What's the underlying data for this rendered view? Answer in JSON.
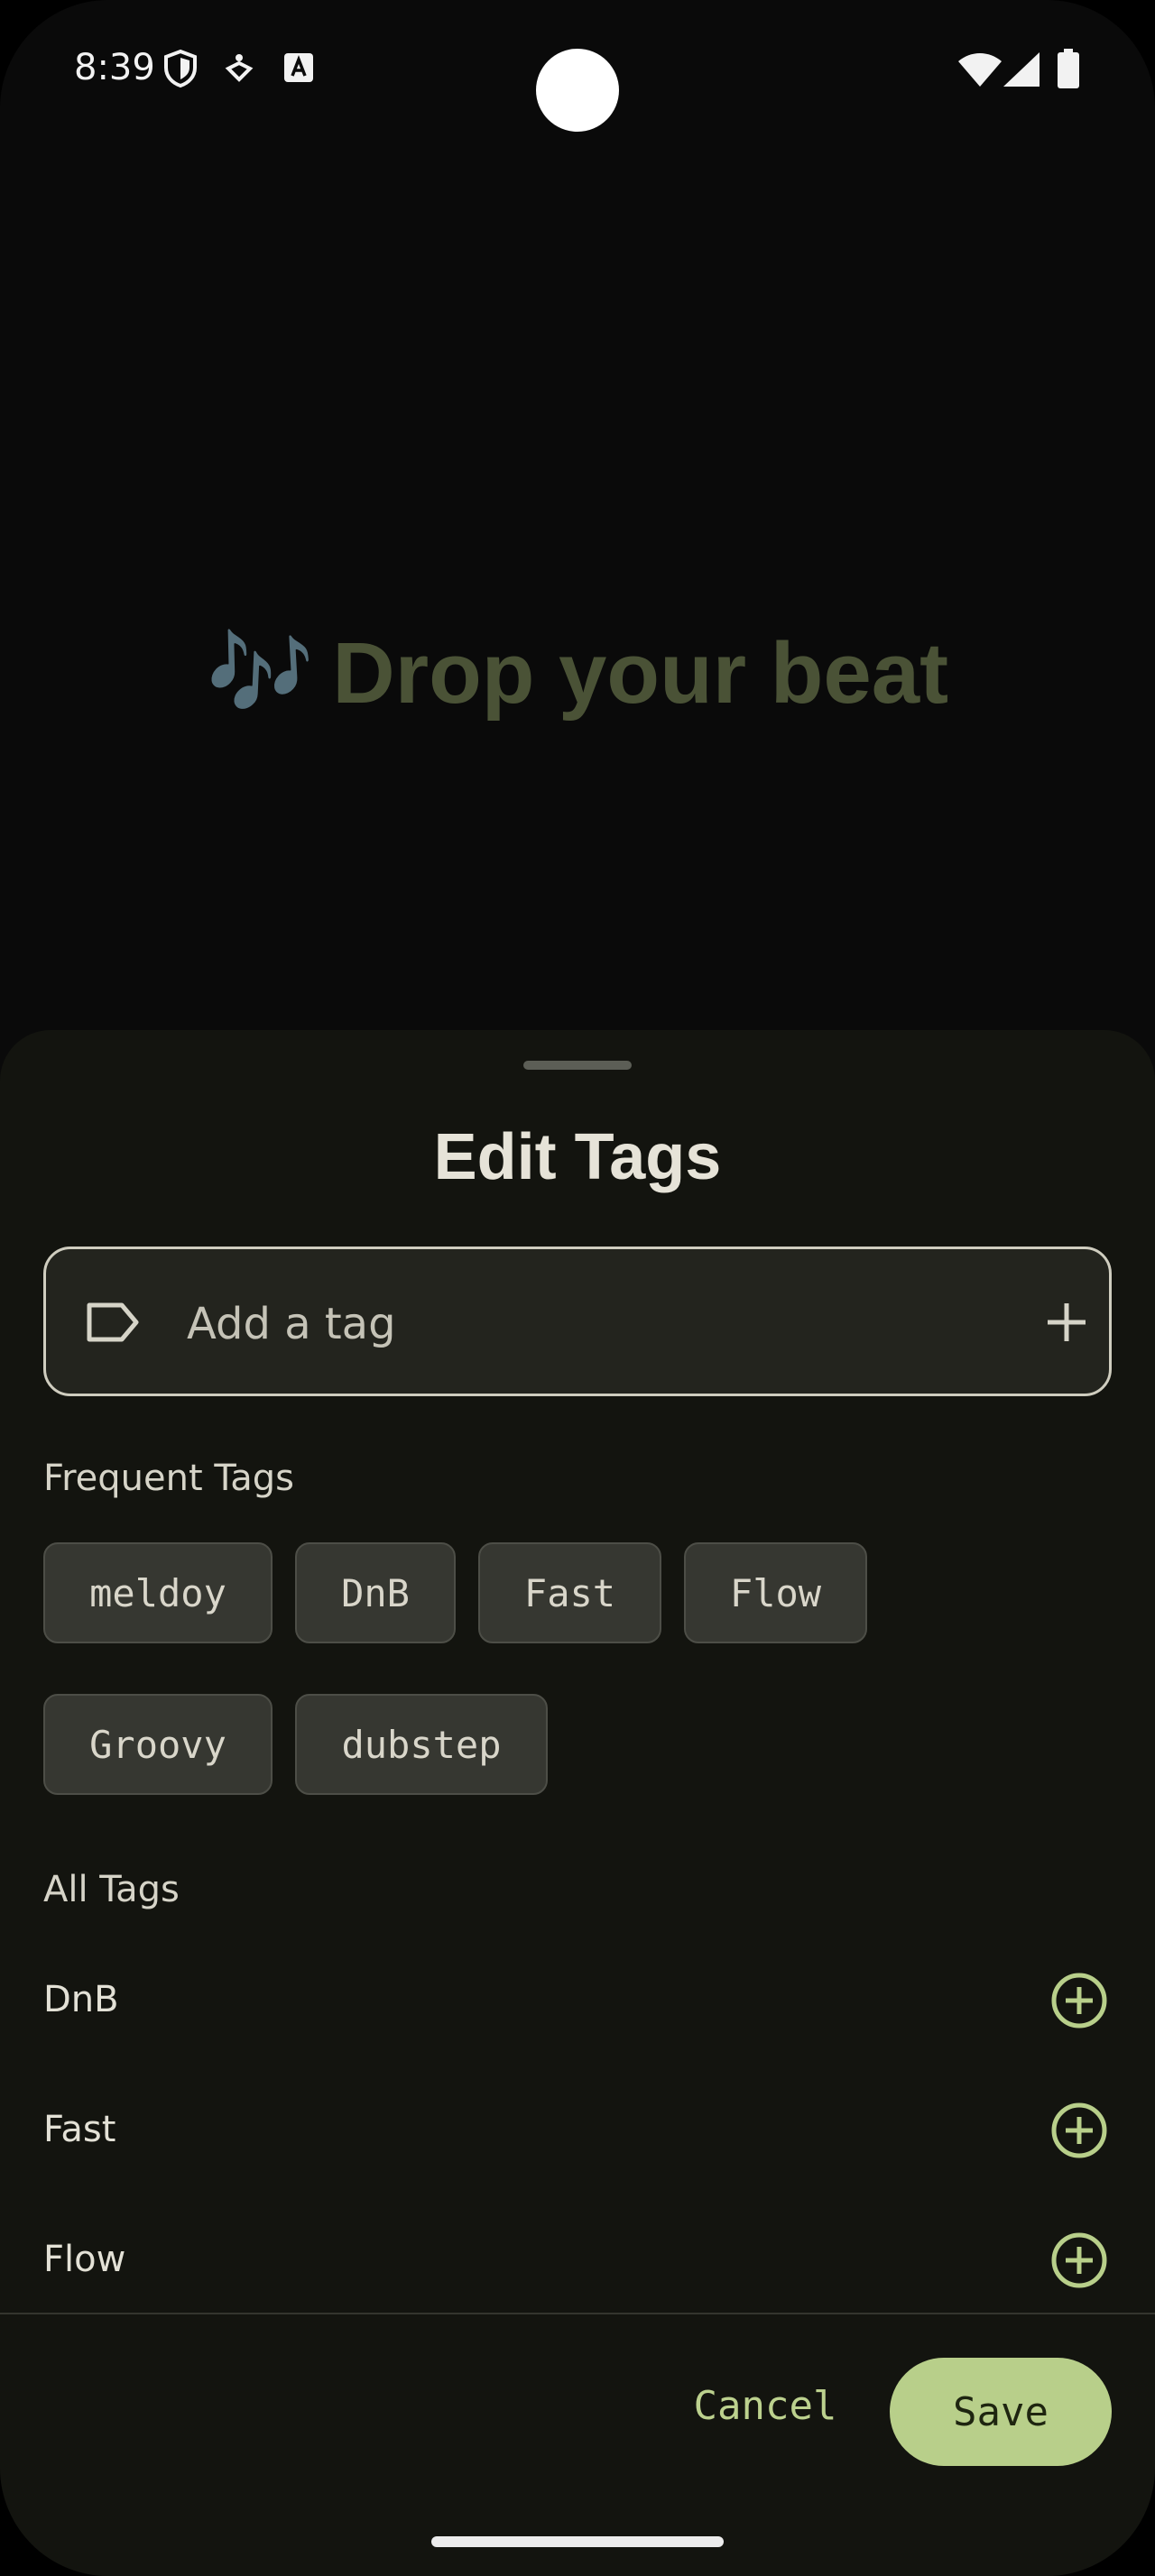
{
  "status_bar": {
    "time": "8:39"
  },
  "background": {
    "hero_emoji": "🎶",
    "hero_text": "Drop your beat"
  },
  "sheet": {
    "title": "Edit Tags",
    "input": {
      "placeholder": "Add a tag",
      "value": ""
    },
    "frequent_label": "Frequent Tags",
    "frequent_tags": [
      "meldoy",
      "DnB",
      "Fast",
      "Flow",
      "Groovy",
      "dubstep"
    ],
    "all_label": "All Tags",
    "all_tags": [
      "DnB",
      "Fast",
      "Flow"
    ],
    "cancel_label": "Cancel",
    "save_label": "Save"
  },
  "colors": {
    "accent": "#b8cf8a",
    "sheet_bg": "#13140f",
    "chip_bg": "#363731",
    "hero_text": "#4a5236"
  },
  "icons": {
    "tag_field_leading": "label-icon",
    "tag_field_trailing": "plus-icon",
    "row_action": "add-circle-icon"
  }
}
